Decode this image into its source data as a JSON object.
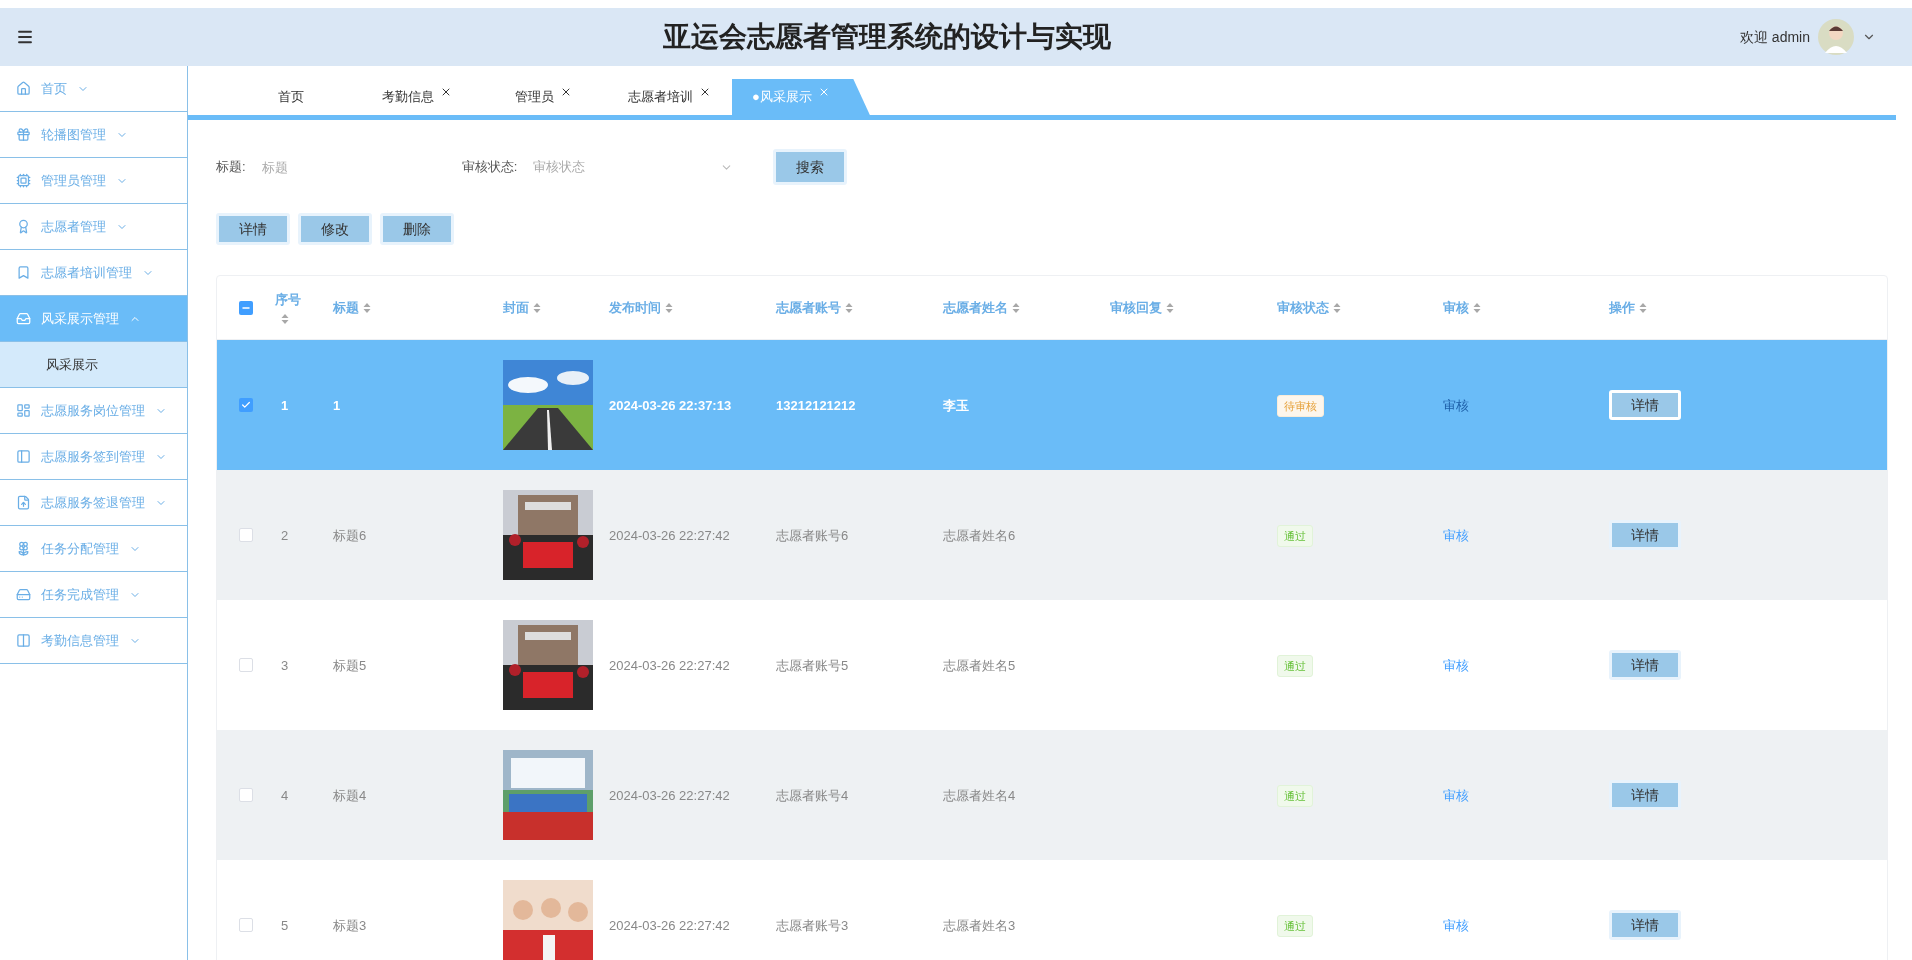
{
  "header": {
    "title": "亚运会志愿者管理系统的设计与实现",
    "welcome": "欢迎 admin"
  },
  "sidebar": {
    "items": [
      {
        "label": "首页",
        "expanded": false,
        "selected": false
      },
      {
        "label": "轮播图管理",
        "expanded": false,
        "selected": false
      },
      {
        "label": "管理员管理",
        "expanded": false,
        "selected": false
      },
      {
        "label": "志愿者管理",
        "expanded": false,
        "selected": false
      },
      {
        "label": "志愿者培训管理",
        "expanded": false,
        "selected": false
      },
      {
        "label": "风采展示管理",
        "expanded": true,
        "selected": true,
        "children": [
          {
            "label": "风采展示",
            "selected": true
          }
        ]
      },
      {
        "label": "志愿服务岗位管理",
        "expanded": false,
        "selected": false
      },
      {
        "label": "志愿服务签到管理",
        "expanded": false,
        "selected": false
      },
      {
        "label": "志愿服务签退管理",
        "expanded": false,
        "selected": false
      },
      {
        "label": "任务分配管理",
        "expanded": false,
        "selected": false
      },
      {
        "label": "任务完成管理",
        "expanded": false,
        "selected": false
      },
      {
        "label": "考勤信息管理",
        "expanded": false,
        "selected": false
      }
    ]
  },
  "tabs": [
    {
      "label": "首页",
      "selected": false,
      "closable": false
    },
    {
      "label": "考勤信息",
      "selected": false,
      "closable": true
    },
    {
      "label": "管理员",
      "selected": false,
      "closable": true
    },
    {
      "label": "志愿者培训",
      "selected": false,
      "closable": true
    },
    {
      "label": "●风采展示",
      "selected": true,
      "closable": true
    }
  ],
  "search": {
    "fields": [
      {
        "label": "标题:",
        "placeholder": "标题",
        "kind": "text"
      },
      {
        "label": "审核状态:",
        "placeholder": "审核状态",
        "kind": "select"
      }
    ],
    "button": "搜索"
  },
  "actions": [
    "详情",
    "修改",
    "删除"
  ],
  "table": {
    "select_all_partial": true,
    "columns": [
      "序号",
      "标题",
      "封面",
      "发布时间",
      "志愿者账号",
      "志愿者姓名",
      "审核回复",
      "审核状态",
      "审核",
      "操作"
    ],
    "rows": [
      {
        "selected": true,
        "checked": true,
        "index": "1",
        "title": "1",
        "time": "2024-03-26 22:37:13",
        "account": "13212121212",
        "name": "李玉",
        "status": "待审核",
        "kind": "pending",
        "review": "审核",
        "action": "详情"
      },
      {
        "selected": false,
        "checked": false,
        "index": "2",
        "title": "标题6",
        "time": "2024-03-26 22:27:42",
        "account": "志愿者账号6",
        "name": "志愿者姓名6",
        "status": "通过",
        "kind": "passed",
        "review": "审核",
        "action": "详情"
      },
      {
        "selected": false,
        "checked": false,
        "index": "3",
        "title": "标题5",
        "time": "2024-03-26 22:27:42",
        "account": "志愿者账号5",
        "name": "志愿者姓名5",
        "status": "通过",
        "kind": "passed",
        "review": "审核",
        "action": "详情"
      },
      {
        "selected": false,
        "checked": false,
        "index": "4",
        "title": "标题4",
        "time": "2024-03-26 22:27:42",
        "account": "志愿者账号4",
        "name": "志愿者姓名4",
        "status": "通过",
        "kind": "passed",
        "review": "审核",
        "action": "详情"
      },
      {
        "selected": false,
        "checked": false,
        "index": "5",
        "title": "标题3",
        "time": "2024-03-26 22:27:42",
        "account": "志愿者账号3",
        "name": "志愿者姓名3",
        "status": "通过",
        "kind": "passed",
        "review": "审核",
        "action": "详情"
      }
    ]
  }
}
